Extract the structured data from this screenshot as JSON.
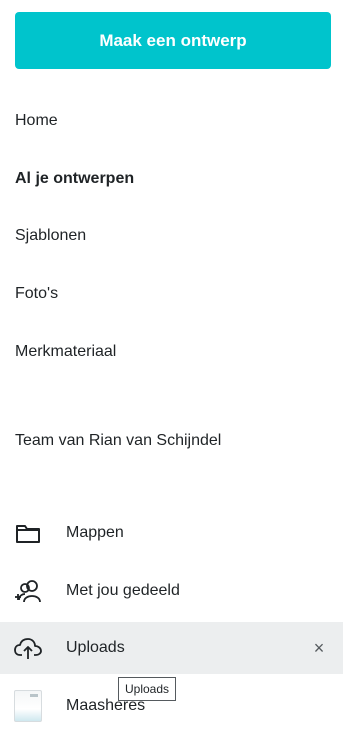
{
  "cta": {
    "label": "Maak een ontwerp"
  },
  "nav": [
    {
      "label": "Home",
      "active": false
    },
    {
      "label": "Al je ontwerpen",
      "active": true
    },
    {
      "label": "Sjablonen",
      "active": false
    },
    {
      "label": "Foto's",
      "active": false
    },
    {
      "label": "Merkmateriaal",
      "active": false
    }
  ],
  "team": {
    "label": "Team van Rian van Schijndel"
  },
  "folders": [
    {
      "label": "Mappen",
      "icon": "folder-icon"
    },
    {
      "label": "Met jou gedeeld",
      "icon": "shared-users-icon"
    },
    {
      "label": "Uploads",
      "icon": "cloud-upload-icon",
      "close_glyph": "×"
    },
    {
      "label": "Maasheres",
      "icon": "design-thumbnail"
    }
  ],
  "tooltip": {
    "label": "Uploads"
  },
  "colors": {
    "accent": "#00c4cc",
    "hover_bg": "#eceeef",
    "text": "#1f2326"
  }
}
